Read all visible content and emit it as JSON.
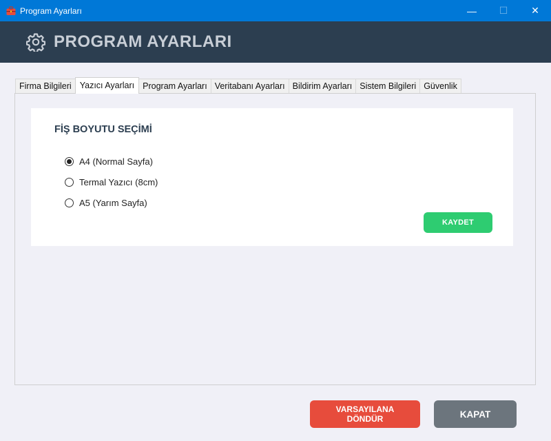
{
  "window": {
    "title": "Program Ayarları",
    "icon": "toolbox-icon",
    "controls": {
      "minimize": "—",
      "maximize": "☐",
      "close": "✕"
    }
  },
  "header": {
    "icon": "gear-icon",
    "title": "PROGRAM AYARLARI"
  },
  "tabs": [
    {
      "label": "Firma Bilgileri",
      "active": false
    },
    {
      "label": "Yazıcı Ayarları",
      "active": true
    },
    {
      "label": "Program Ayarları",
      "active": false
    },
    {
      "label": "Veritabanı Ayarları",
      "active": false
    },
    {
      "label": "Bildirim Ayarları",
      "active": false
    },
    {
      "label": "Sistem Bilgileri",
      "active": false
    },
    {
      "label": "Güvenlik",
      "active": false
    }
  ],
  "printer_settings": {
    "section_title": "FİŞ BOYUTU SEÇİMİ",
    "options": [
      {
        "label": "A4 (Normal Sayfa)",
        "checked": true
      },
      {
        "label": "Termal Yazıcı (8cm)",
        "checked": false
      },
      {
        "label": "A5 (Yarım Sayfa)",
        "checked": false
      }
    ],
    "save_label": "KAYDET"
  },
  "footer": {
    "reset_label": "VARSAYILANA DÖNDÜR",
    "close_label": "KAPAT"
  },
  "colors": {
    "titlebar": "#0078d7",
    "header": "#2c3e50",
    "save": "#2ecc71",
    "reset": "#e74c3c",
    "close": "#6c757d"
  }
}
